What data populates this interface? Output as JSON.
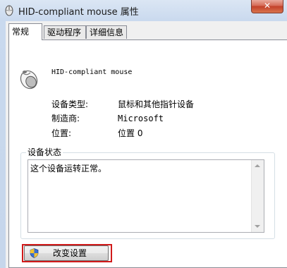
{
  "window": {
    "title": "HID-compliant mouse 属性",
    "close_label": "✕"
  },
  "tabs": [
    {
      "label": "常规"
    },
    {
      "label": "驱动程序"
    },
    {
      "label": "详细信息"
    }
  ],
  "device": {
    "name": "HID-compliant mouse",
    "icon": "mouse-icon",
    "properties": [
      {
        "label": "设备类型:",
        "value": "鼠标和其他指针设备"
      },
      {
        "label": "制造商:",
        "value": "Microsoft"
      },
      {
        "label": "位置:",
        "value": "位置 0"
      }
    ]
  },
  "status_group": {
    "legend": "设备状态",
    "text": "这个设备运转正常。"
  },
  "actions": {
    "change_settings": "改变设置",
    "shield_icon": "uac-shield-icon"
  },
  "colors": {
    "highlight": "#d11a1a"
  }
}
